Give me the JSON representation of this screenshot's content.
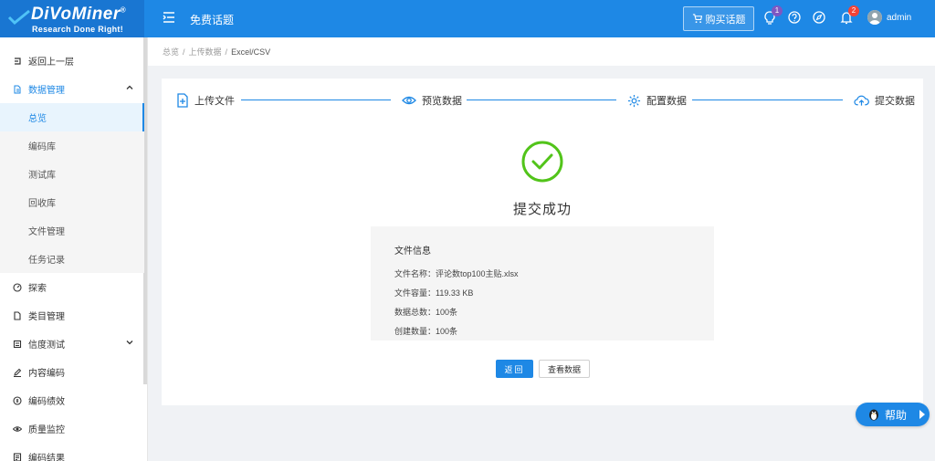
{
  "header": {
    "brand": "iVoMiner",
    "brand_initial": "D",
    "brand_mark": "®",
    "tagline": "Research Done Right!",
    "title": "免费话题",
    "buy_label": "购买话题",
    "lightbulb_badge": "1",
    "notification_badge": "2",
    "username": "admin"
  },
  "sidebar": {
    "items": [
      {
        "label": "返回上一层"
      },
      {
        "label": "数据管理"
      },
      {
        "label": "总览"
      },
      {
        "label": "编码库"
      },
      {
        "label": "测试库"
      },
      {
        "label": "回收库"
      },
      {
        "label": "文件管理"
      },
      {
        "label": "任务记录"
      },
      {
        "label": "探索"
      },
      {
        "label": "类目管理"
      },
      {
        "label": "信度测试"
      },
      {
        "label": "内容编码"
      },
      {
        "label": "编码绩效"
      },
      {
        "label": "质量监控"
      },
      {
        "label": "编码结果"
      }
    ]
  },
  "breadcrumb": {
    "items": [
      "总览",
      "上传数据",
      "Excel/CSV"
    ]
  },
  "steps": [
    {
      "label": "上传文件"
    },
    {
      "label": "预览数据"
    },
    {
      "label": "配置数据"
    },
    {
      "label": "提交数据"
    }
  ],
  "result": {
    "title": "提交成功",
    "info_title": "文件信息",
    "file_name": "文件名称：评论数top100主贴.xlsx",
    "file_size": "文件容量：119.33 KB",
    "total_rows": "数据总数：100条",
    "created_rows": "创建数量：100条"
  },
  "buttons": {
    "back": "返回",
    "view_data": "查看数据"
  },
  "help": {
    "label": "帮助"
  },
  "colors": {
    "primary": "#1e88e5",
    "success": "#52c41a"
  }
}
